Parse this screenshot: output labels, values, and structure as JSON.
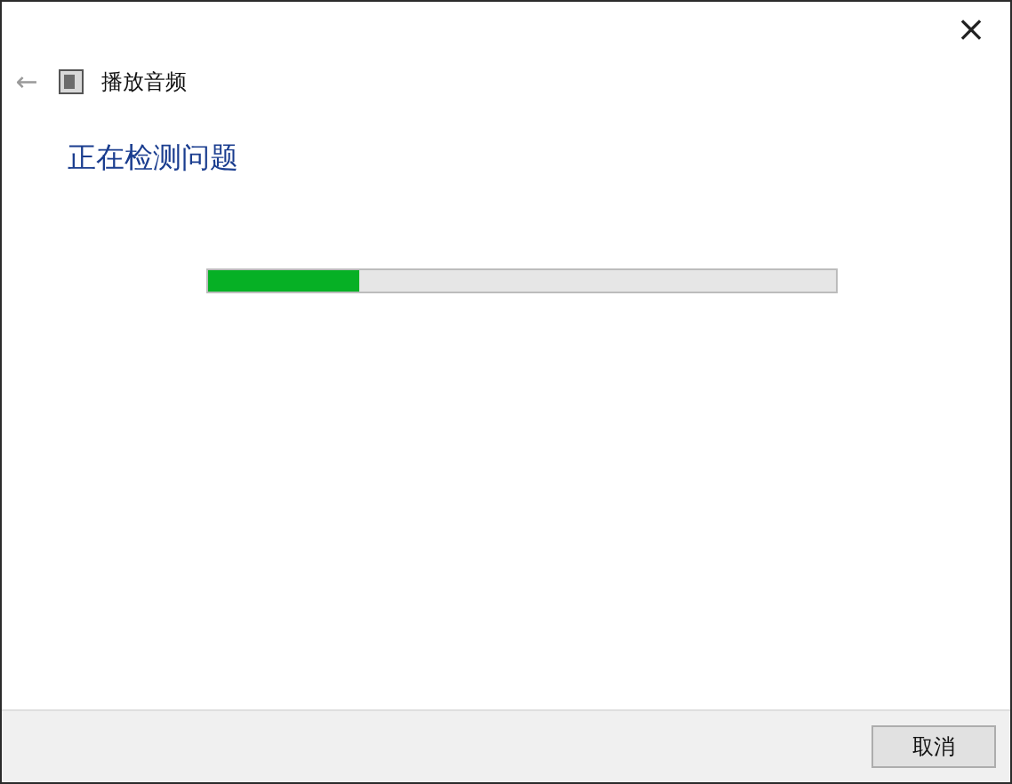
{
  "window": {
    "close": "×"
  },
  "header": {
    "back": "←",
    "title": "播放音频"
  },
  "heading": "正在检测问题",
  "progress": {
    "level": 0.24
  },
  "buttons": [
    {
      "label": "取消",
      "disabled": false
    }
  ]
}
